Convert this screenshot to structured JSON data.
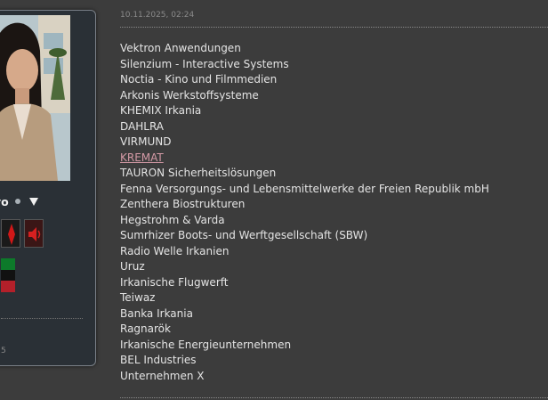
{
  "profile": {
    "username_fragment": "yo",
    "foot_fragment": "5",
    "flag_colors": [
      "#0d7a2a",
      "#111111",
      "#b3202a"
    ]
  },
  "post": {
    "date": "10.11.2025, 02:24",
    "companies": [
      {
        "name": "Vektron Anwendungen",
        "link": false
      },
      {
        "name": "Silenzium - Interactive Systems",
        "link": false
      },
      {
        "name": "Noctia - Kino und Filmmedien",
        "link": false
      },
      {
        "name": "Arkonis Werkstoffsysteme",
        "link": false
      },
      {
        "name": "KHEMIX Irkania",
        "link": false
      },
      {
        "name": "DAHLRA",
        "link": false
      },
      {
        "name": "VIRMUND",
        "link": false
      },
      {
        "name": "KREMAT",
        "link": true
      },
      {
        "name": "TAURON Sicherheitslösungen",
        "link": false
      },
      {
        "name": "Fenna Versorgungs- und Lebensmittelwerke der Freien Republik mbH",
        "link": false
      },
      {
        "name": "Zenthera Biostrukturen",
        "link": false
      },
      {
        "name": "Hegstrohm & Varda",
        "link": false
      },
      {
        "name": "Sumrhizer Boots- und Werftgesellschaft (SBW)",
        "link": false
      },
      {
        "name": "Radio Welle Irkanien",
        "link": false
      },
      {
        "name": "Uruz",
        "link": false
      },
      {
        "name": "Irkanische Flugwerft",
        "link": false
      },
      {
        "name": "Teiwaz",
        "link": false
      },
      {
        "name": "Banka Irkania",
        "link": false
      },
      {
        "name": "Ragnarök",
        "link": false
      },
      {
        "name": "Irkanische Energieunternehmen",
        "link": false
      },
      {
        "name": "BEL Industries",
        "link": false
      },
      {
        "name": "Unternehmen X",
        "link": false
      }
    ]
  }
}
